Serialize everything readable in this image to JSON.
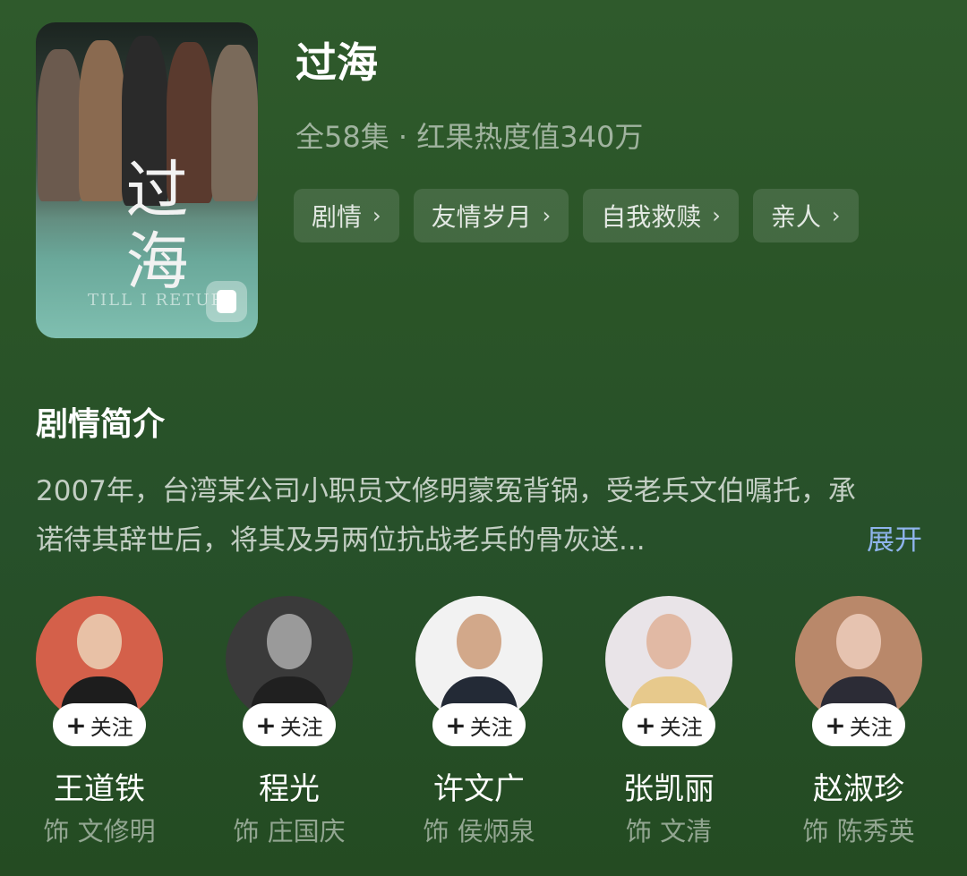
{
  "show": {
    "poster_alt": "过海 poster",
    "poster_text_cn": "过海",
    "poster_text_en": "TILL I RETUR",
    "title": "过海",
    "meta": "全58集 · 红果热度值340万",
    "tags": [
      "剧情",
      "友情岁月",
      "自我救赎",
      "亲人"
    ]
  },
  "synopsis": {
    "heading": "剧情简介",
    "text": "2007年，台湾某公司小职员文修明蒙冤背锅，受老兵文伯嘱托，承诺待其辞世后，将其及另两位抗战老兵的骨灰送...",
    "expand_label": "展开"
  },
  "cast": [
    {
      "name": "王道铁",
      "role": "饰 文修明",
      "follow_label": "关注",
      "avatar_color": "#d4604a"
    },
    {
      "name": "程光",
      "role": "饰 庄国庆",
      "follow_label": "关注",
      "avatar_color": "#3a3a3a"
    },
    {
      "name": "许文广",
      "role": "饰 侯炳泉",
      "follow_label": "关注",
      "avatar_color": "#f2f2f2"
    },
    {
      "name": "张凯丽",
      "role": "饰 文清",
      "follow_label": "关注",
      "avatar_color": "#e9e4e8"
    },
    {
      "name": "赵淑珍",
      "role": "饰 陈秀英",
      "follow_label": "关注",
      "avatar_color": "#b9886a"
    }
  ]
}
